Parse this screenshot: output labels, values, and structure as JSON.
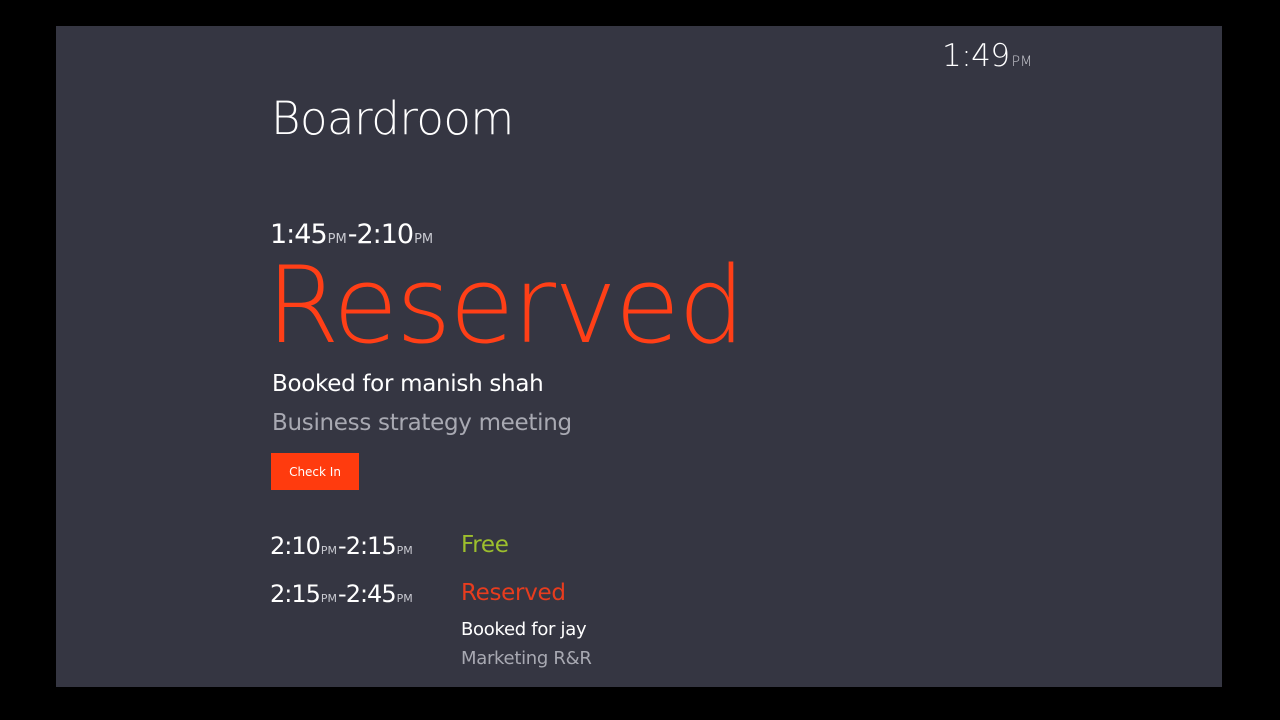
{
  "clock": {
    "time": "1:49",
    "ampm": "PM"
  },
  "room": {
    "name": "Boardroom"
  },
  "current": {
    "start": "1:45",
    "start_ampm": "PM",
    "separator": "-",
    "end": "2:10",
    "end_ampm": "PM",
    "status": "Reserved",
    "booked_for": "Booked for manish shah",
    "subject": "Business strategy meeting",
    "checkin_label": "Check In"
  },
  "upcoming": [
    {
      "start": "2:10",
      "start_ampm": "PM",
      "separator": "-",
      "end": "2:15",
      "end_ampm": "PM",
      "status": "Free"
    },
    {
      "start": "2:15",
      "start_ampm": "PM",
      "separator": "-",
      "end": "2:45",
      "end_ampm": "PM",
      "status": "Reserved",
      "booked_for": "Booked for jay",
      "subject": "Marketing R&R"
    }
  ],
  "colors": {
    "background": "#353642",
    "reserved": "#ff3f17",
    "free": "#9dbf2d",
    "button": "#ff3b0e"
  }
}
